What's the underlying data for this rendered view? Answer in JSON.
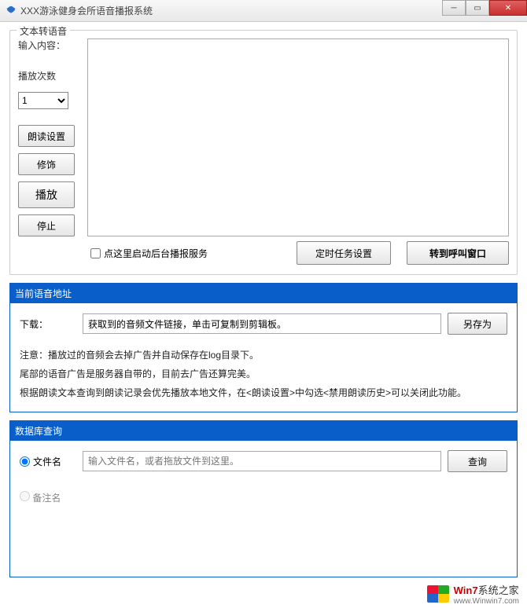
{
  "window": {
    "title": "XXX游泳健身会所语音播报系统"
  },
  "tts": {
    "legend": "文本转语音",
    "input_label": "输入内容：",
    "input_value": "",
    "play_count_label": "播放次数",
    "play_count_value": "1",
    "btn_read_settings": "朗读设置",
    "btn_modify": "修饰",
    "btn_play": "播放",
    "btn_stop": "停止",
    "checkbox_bg_service": "点这里启动后台播报服务",
    "btn_timer_settings": "定时任务设置",
    "btn_goto_call": "转到呼叫窗口"
  },
  "voice_addr": {
    "header": "当前语音地址",
    "download_label": "下载：",
    "download_value": "获取到的音频文件链接，单击可复制到剪辑板。",
    "btn_save_as": "另存为",
    "note1": "注意：播放过的音频会去掉广告并自动保存在log目录下。",
    "note2": "尾部的语音广告是服务器自带的，目前去广告还算完美。",
    "note3": "根据朗读文本查询到朗读记录会优先播放本地文件，在<朗读设置>中勾选<禁用朗读历史>可以关闭此功能。"
  },
  "db_query": {
    "header": "数据库查询",
    "radio_filename": "文件名",
    "radio_remark": "备注名",
    "input_placeholder": "输入文件名，或者拖放文件到这里。",
    "input_value": "",
    "btn_query": "查询"
  },
  "watermark": {
    "line1_a": "Win7",
    "line1_b": "系统之家",
    "line2": "www.Winwin7.com"
  }
}
